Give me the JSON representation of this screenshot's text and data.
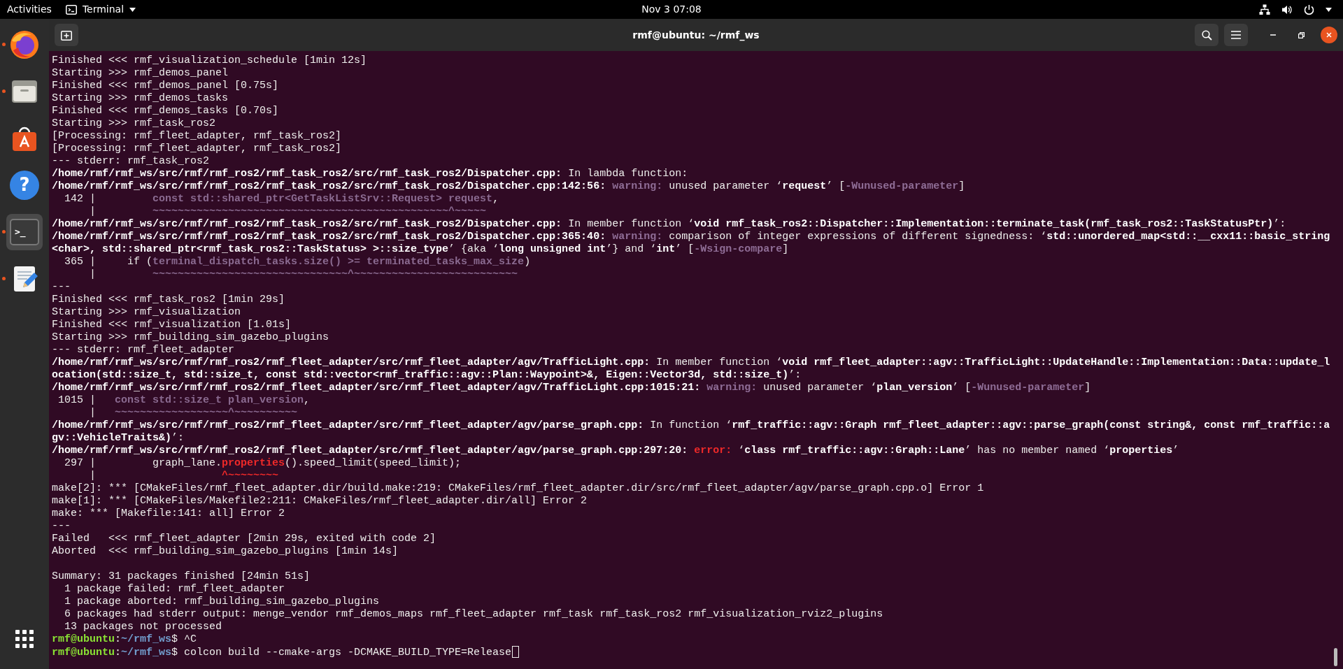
{
  "top_bar": {
    "activities": "Activities",
    "app_menu": "Terminal",
    "clock": "Nov 3  07:08"
  },
  "dock": {
    "apps": [
      {
        "kind": "browser",
        "running": true,
        "selected": false
      },
      {
        "kind": "files",
        "running": true,
        "selected": false
      },
      {
        "kind": "software",
        "running": false,
        "selected": false
      },
      {
        "kind": "help",
        "glyph": "?",
        "running": false,
        "selected": false
      },
      {
        "kind": "terminal",
        "glyph": ">_",
        "running": true,
        "selected": true
      },
      {
        "kind": "editor",
        "running": true,
        "selected": false
      }
    ]
  },
  "window": {
    "title": "rmf@ubuntu: ~/rmf_ws"
  },
  "terminal": {
    "lines": [
      {
        "segments": [
          {
            "text": "Finished <<< rmf_visualization_schedule [1min 12s]",
            "kind": "text"
          }
        ]
      },
      {
        "segments": [
          {
            "text": "Starting >>> rmf_demos_panel",
            "kind": "text"
          }
        ]
      },
      {
        "segments": [
          {
            "text": "Finished <<< rmf_demos_panel [0.75s]",
            "kind": "text"
          }
        ]
      },
      {
        "segments": [
          {
            "text": "Starting >>> rmf_demos_tasks",
            "kind": "text"
          }
        ]
      },
      {
        "segments": [
          {
            "text": "Finished <<< rmf_demos_tasks [0.70s]",
            "kind": "text"
          }
        ]
      },
      {
        "segments": [
          {
            "text": "Starting >>> rmf_task_ros2",
            "kind": "text"
          }
        ]
      },
      {
        "segments": [
          {
            "text": "[Processing: rmf_fleet_adapter, rmf_task_ros2]",
            "kind": "text"
          }
        ]
      },
      {
        "segments": [
          {
            "text": "[Processing: rmf_fleet_adapter, rmf_task_ros2]",
            "kind": "text"
          }
        ]
      },
      {
        "segments": [
          {
            "text": "--- stderr: rmf_task_ros2",
            "kind": "text"
          }
        ]
      },
      {
        "segments": [
          {
            "text": "/home/rmf/rmf_ws/src/rmf/rmf_ros2/rmf_task_ros2/src/rmf_task_ros2/Dispatcher.cpp:",
            "kind": "bold"
          },
          {
            "text": " In lambda function:",
            "kind": "text"
          }
        ]
      },
      {
        "segments": [
          {
            "text": "/home/rmf/rmf_ws/src/rmf/rmf_ros2/rmf_task_ros2/src/rmf_task_ros2/Dispatcher.cpp:142:56: ",
            "kind": "bold"
          },
          {
            "text": "warning:",
            "kind": "warning"
          },
          {
            "text": " unused parameter ‘",
            "kind": "text"
          },
          {
            "text": "request",
            "kind": "bold"
          },
          {
            "text": "’ [",
            "kind": "text"
          },
          {
            "text": "-Wunused-parameter",
            "kind": "warning"
          },
          {
            "text": "]",
            "kind": "text"
          }
        ]
      },
      {
        "segments": [
          {
            "text": "  142 |         ",
            "kind": "text"
          },
          {
            "text": "const std::shared_ptr<GetTaskListSrv::Request> request",
            "kind": "source"
          },
          {
            "text": ",",
            "kind": "text"
          }
        ]
      },
      {
        "segments": [
          {
            "text": "      |         ",
            "kind": "text"
          },
          {
            "text": "~~~~~~~~~~~~~~~~~~~~~~~~~~~~~~~~~~~~~~~~~~~~~~~^~~~~~",
            "kind": "source"
          }
        ]
      },
      {
        "segments": [
          {
            "text": "/home/rmf/rmf_ws/src/rmf/rmf_ros2/rmf_task_ros2/src/rmf_task_ros2/Dispatcher.cpp:",
            "kind": "bold"
          },
          {
            "text": " In member function ‘",
            "kind": "text"
          },
          {
            "text": "void rmf_task_ros2::Dispatcher::Implementation::terminate_task(rmf_task_ros2::TaskStatusPtr)",
            "kind": "bold"
          },
          {
            "text": "’:",
            "kind": "text"
          }
        ]
      },
      {
        "segments": [
          {
            "text": "/home/rmf/rmf_ws/src/rmf/rmf_ros2/rmf_task_ros2/src/rmf_task_ros2/Dispatcher.cpp:365:40: ",
            "kind": "bold"
          },
          {
            "text": "warning:",
            "kind": "warning"
          },
          {
            "text": " comparison of integer expressions of different signedness: ‘",
            "kind": "text"
          },
          {
            "text": "std::unordered_map<std::__cxx11::basic_string",
            "kind": "bold"
          }
        ]
      },
      {
        "segments": [
          {
            "text": "<char>, std::shared_ptr<rmf_task_ros2::TaskStatus> >::size_type",
            "kind": "bold"
          },
          {
            "text": "’ {aka ‘",
            "kind": "text"
          },
          {
            "text": "long unsigned int",
            "kind": "bold"
          },
          {
            "text": "’} and ‘",
            "kind": "text"
          },
          {
            "text": "int",
            "kind": "bold"
          },
          {
            "text": "’ [",
            "kind": "text"
          },
          {
            "text": "-Wsign-compare",
            "kind": "warning"
          },
          {
            "text": "]",
            "kind": "text"
          }
        ]
      },
      {
        "segments": [
          {
            "text": "  365 |     if (",
            "kind": "text"
          },
          {
            "text": "terminal_dispatch_tasks.size() >= terminated_tasks_max_size",
            "kind": "source"
          },
          {
            "text": ")",
            "kind": "text"
          }
        ]
      },
      {
        "segments": [
          {
            "text": "      |         ",
            "kind": "text"
          },
          {
            "text": "~~~~~~~~~~~~~~~~~~~~~~~~~~~~~~~^~~~~~~~~~~~~~~~~~~~~~~~~~~",
            "kind": "source"
          }
        ]
      },
      {
        "segments": [
          {
            "text": "---",
            "kind": "text"
          }
        ]
      },
      {
        "segments": [
          {
            "text": "Finished <<< rmf_task_ros2 [1min 29s]",
            "kind": "text"
          }
        ]
      },
      {
        "segments": [
          {
            "text": "Starting >>> rmf_visualization",
            "kind": "text"
          }
        ]
      },
      {
        "segments": [
          {
            "text": "Finished <<< rmf_visualization [1.01s]",
            "kind": "text"
          }
        ]
      },
      {
        "segments": [
          {
            "text": "Starting >>> rmf_building_sim_gazebo_plugins",
            "kind": "text"
          }
        ]
      },
      {
        "segments": [
          {
            "text": "--- stderr: rmf_fleet_adapter",
            "kind": "text"
          }
        ]
      },
      {
        "segments": [
          {
            "text": "/home/rmf/rmf_ws/src/rmf/rmf_ros2/rmf_fleet_adapter/src/rmf_fleet_adapter/agv/TrafficLight.cpp:",
            "kind": "bold"
          },
          {
            "text": " In member function ‘",
            "kind": "text"
          },
          {
            "text": "void rmf_fleet_adapter::agv::TrafficLight::UpdateHandle::Implementation::Data::update_l",
            "kind": "bold"
          }
        ]
      },
      {
        "segments": [
          {
            "text": "ocation(std::size_t, std::size_t, const std::vector<rmf_traffic::agv::Plan::Waypoint>&, Eigen::Vector3d, std::size_t)",
            "kind": "bold"
          },
          {
            "text": "’:",
            "kind": "text"
          }
        ]
      },
      {
        "segments": [
          {
            "text": "/home/rmf/rmf_ws/src/rmf/rmf_ros2/rmf_fleet_adapter/src/rmf_fleet_adapter/agv/TrafficLight.cpp:1015:21: ",
            "kind": "bold"
          },
          {
            "text": "warning:",
            "kind": "warning"
          },
          {
            "text": " unused parameter ‘",
            "kind": "text"
          },
          {
            "text": "plan_version",
            "kind": "bold"
          },
          {
            "text": "’ [",
            "kind": "text"
          },
          {
            "text": "-Wunused-parameter",
            "kind": "warning"
          },
          {
            "text": "]",
            "kind": "text"
          }
        ]
      },
      {
        "segments": [
          {
            "text": " 1015 |   ",
            "kind": "text"
          },
          {
            "text": "const std::size_t plan_version",
            "kind": "source"
          },
          {
            "text": ",",
            "kind": "text"
          }
        ]
      },
      {
        "segments": [
          {
            "text": "      |   ",
            "kind": "text"
          },
          {
            "text": "~~~~~~~~~~~~~~~~~~^~~~~~~~~~~",
            "kind": "source"
          }
        ]
      },
      {
        "segments": [
          {
            "text": "/home/rmf/rmf_ws/src/rmf/rmf_ros2/rmf_fleet_adapter/src/rmf_fleet_adapter/agv/parse_graph.cpp:",
            "kind": "bold"
          },
          {
            "text": " In function ‘",
            "kind": "text"
          },
          {
            "text": "rmf_traffic::agv::Graph rmf_fleet_adapter::agv::parse_graph(const string&, const rmf_traffic::a",
            "kind": "bold"
          }
        ]
      },
      {
        "segments": [
          {
            "text": "gv::VehicleTraits&)",
            "kind": "bold"
          },
          {
            "text": "’:",
            "kind": "text"
          }
        ]
      },
      {
        "segments": [
          {
            "text": "/home/rmf/rmf_ws/src/rmf/rmf_ros2/rmf_fleet_adapter/src/rmf_fleet_adapter/agv/parse_graph.cpp:297:20: ",
            "kind": "bold"
          },
          {
            "text": "error:",
            "kind": "error"
          },
          {
            "text": " ‘",
            "kind": "text"
          },
          {
            "text": "class rmf_traffic::agv::Graph::Lane",
            "kind": "bold"
          },
          {
            "text": "’ has no member named ‘",
            "kind": "text"
          },
          {
            "text": "properties",
            "kind": "bold"
          },
          {
            "text": "’",
            "kind": "text"
          }
        ]
      },
      {
        "segments": [
          {
            "text": "  297 |         graph_lane.",
            "kind": "text"
          },
          {
            "text": "properties",
            "kind": "error"
          },
          {
            "text": "().speed_limit(speed_limit);",
            "kind": "text"
          }
        ]
      },
      {
        "segments": [
          {
            "text": "      |                    ",
            "kind": "text"
          },
          {
            "text": "^~~~~~~~~",
            "kind": "error"
          }
        ]
      },
      {
        "segments": [
          {
            "text": "make[2]: *** [CMakeFiles/rmf_fleet_adapter.dir/build.make:219: CMakeFiles/rmf_fleet_adapter.dir/src/rmf_fleet_adapter/agv/parse_graph.cpp.o] Error 1",
            "kind": "text"
          }
        ]
      },
      {
        "segments": [
          {
            "text": "make[1]: *** [CMakeFiles/Makefile2:211: CMakeFiles/rmf_fleet_adapter.dir/all] Error 2",
            "kind": "text"
          }
        ]
      },
      {
        "segments": [
          {
            "text": "make: *** [Makefile:141: all] Error 2",
            "kind": "text"
          }
        ]
      },
      {
        "segments": [
          {
            "text": "---",
            "kind": "text"
          }
        ]
      },
      {
        "segments": [
          {
            "text": "Failed   <<< rmf_fleet_adapter [2min 29s, exited with code 2]",
            "kind": "text"
          }
        ]
      },
      {
        "segments": [
          {
            "text": "Aborted  <<< rmf_building_sim_gazebo_plugins [1min 14s]",
            "kind": "text"
          }
        ]
      },
      {
        "blank": true
      },
      {
        "segments": [
          {
            "text": "Summary: 31 packages finished [24min 51s]",
            "kind": "text"
          }
        ]
      },
      {
        "segments": [
          {
            "text": "  1 package failed: rmf_fleet_adapter",
            "kind": "text"
          }
        ]
      },
      {
        "segments": [
          {
            "text": "  1 package aborted: rmf_building_sim_gazebo_plugins",
            "kind": "text"
          }
        ]
      },
      {
        "segments": [
          {
            "text": "  6 packages had stderr output: menge_vendor rmf_demos_maps rmf_fleet_adapter rmf_task rmf_task_ros2 rmf_visualization_rviz2_plugins",
            "kind": "text"
          }
        ]
      },
      {
        "segments": [
          {
            "text": "  13 packages not processed",
            "kind": "text"
          }
        ]
      },
      {
        "segments": [
          {
            "text": "rmf@ubuntu",
            "kind": "user"
          },
          {
            "text": ":",
            "kind": "text"
          },
          {
            "text": "~/rmf_ws",
            "kind": "path"
          },
          {
            "text": "$ ^C",
            "kind": "text"
          }
        ]
      },
      {
        "segments": [
          {
            "text": "rmf@ubuntu",
            "kind": "user"
          },
          {
            "text": ":",
            "kind": "text"
          },
          {
            "text": "~/rmf_ws",
            "kind": "path"
          },
          {
            "text": "$ colcon build --cmake-args -DCMAKE_BUILD_TYPE=Release",
            "kind": "text"
          }
        ],
        "cursor": true
      }
    ]
  }
}
